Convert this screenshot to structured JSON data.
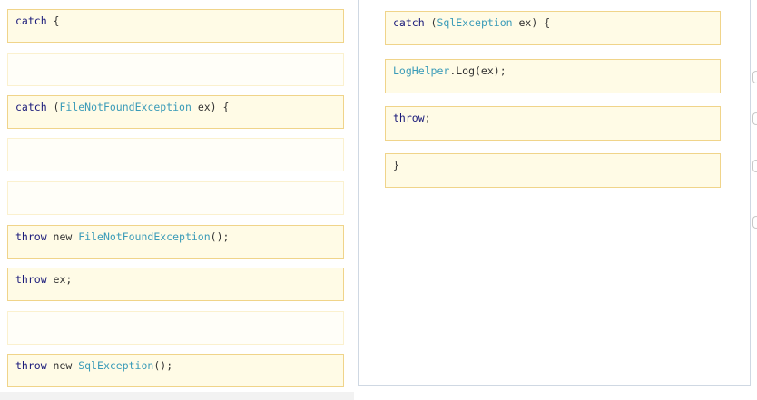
{
  "source_snippets": [
    {
      "id": "catch-plain",
      "parts": [
        {
          "t": "catch",
          "c": "kw"
        },
        {
          "t": " {",
          "c": "pl"
        }
      ]
    },
    {
      "id": "empty-1",
      "parts": []
    },
    {
      "id": "catch-filenotfound",
      "parts": [
        {
          "t": "catch",
          "c": "kw"
        },
        {
          "t": " (",
          "c": "pl"
        },
        {
          "t": "FileNotFoundException",
          "c": "ty"
        },
        {
          "t": " ex) {",
          "c": "pl"
        }
      ]
    },
    {
      "id": "empty-2",
      "parts": []
    },
    {
      "id": "empty-3",
      "parts": []
    },
    {
      "id": "throw-new-filenotfound",
      "parts": [
        {
          "t": "throw",
          "c": "kw"
        },
        {
          "t": " new ",
          "c": "pl"
        },
        {
          "t": "FileNotFoundException",
          "c": "ty"
        },
        {
          "t": "();",
          "c": "pl"
        }
      ]
    },
    {
      "id": "throw-ex",
      "parts": [
        {
          "t": "throw",
          "c": "kw"
        },
        {
          "t": " ex;",
          "c": "pl"
        }
      ]
    },
    {
      "id": "empty-4",
      "parts": []
    },
    {
      "id": "throw-new-sql",
      "parts": [
        {
          "t": "throw",
          "c": "kw"
        },
        {
          "t": " new ",
          "c": "pl"
        },
        {
          "t": "SqlException",
          "c": "ty"
        },
        {
          "t": "();",
          "c": "pl"
        }
      ]
    }
  ],
  "target_snippets": [
    {
      "id": "catch-sql",
      "parts": [
        {
          "t": "catch",
          "c": "kw"
        },
        {
          "t": " (",
          "c": "pl"
        },
        {
          "t": "SqlException",
          "c": "ty"
        },
        {
          "t": " ex) {",
          "c": "pl"
        }
      ]
    },
    {
      "id": "loghelper-log",
      "parts": [
        {
          "t": "LogHelper",
          "c": "ty"
        },
        {
          "t": ".Log(ex);",
          "c": "pl"
        }
      ]
    },
    {
      "id": "throw",
      "parts": [
        {
          "t": "throw",
          "c": "kw"
        },
        {
          "t": ";",
          "c": "pl"
        }
      ]
    },
    {
      "id": "close-brace",
      "parts": [
        {
          "t": "}",
          "c": "pl"
        }
      ]
    }
  ],
  "colors": {
    "keyword": "#1a1a7a",
    "type": "#3a9bb8",
    "snippet_bg": "#fffbe6",
    "snippet_border": "#f0d48a"
  }
}
